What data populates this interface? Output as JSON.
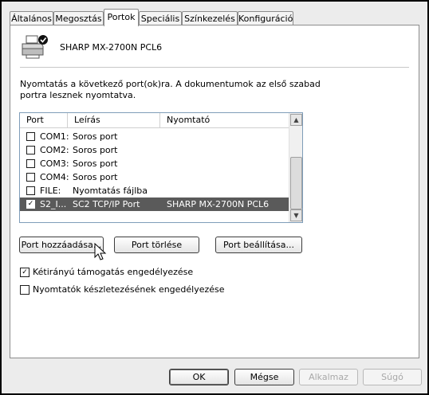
{
  "tabs": [
    {
      "label": "Általános",
      "active": false
    },
    {
      "label": "Megosztás",
      "active": false
    },
    {
      "label": "Portok",
      "active": true
    },
    {
      "label": "Speciális",
      "active": false
    },
    {
      "label": "Színkezelés",
      "active": false
    },
    {
      "label": "Konfiguráció",
      "active": false
    }
  ],
  "printer": {
    "name": "SHARP MX-2700N PCL6",
    "icon": "printer-icon"
  },
  "description": "Nyomtatás a következő port(ok)ra. A dokumentumok az első szabad portra lesznek nyomtatva.",
  "list": {
    "headers": {
      "port": "Port",
      "desc": "Leírás",
      "printer": "Nyomtató"
    },
    "rows": [
      {
        "port": "COM1:",
        "desc": "Soros port",
        "printer": "",
        "checked": false,
        "selected": false
      },
      {
        "port": "COM2:",
        "desc": "Soros port",
        "printer": "",
        "checked": false,
        "selected": false
      },
      {
        "port": "COM3:",
        "desc": "Soros port",
        "printer": "",
        "checked": false,
        "selected": false
      },
      {
        "port": "COM4:",
        "desc": "Soros port",
        "printer": "",
        "checked": false,
        "selected": false
      },
      {
        "port": "FILE:",
        "desc": "Nyomtatás fájlba",
        "printer": "",
        "checked": false,
        "selected": false
      },
      {
        "port": "S2_I...",
        "desc": "SC2 TCP/IP Port",
        "printer": "SHARP MX-2700N PCL6",
        "checked": true,
        "selected": true
      }
    ]
  },
  "buttons": {
    "add_port": "Port hozzáadása...",
    "delete_port": "Port törlése",
    "configure_port": "Port beállítása..."
  },
  "options": {
    "bidirectional": {
      "label": "Kétirányú támogatás engedélyezése",
      "checked": true
    },
    "pooling": {
      "label": "Nyomtatók készletezésének engedélyezése",
      "checked": false
    }
  },
  "dialog_buttons": {
    "ok": "OK",
    "cancel": "Mégse",
    "apply": "Alkalmaz",
    "help": "Súgó"
  },
  "glyphs": {
    "check": "✓",
    "up": "▲",
    "down": "▼"
  }
}
